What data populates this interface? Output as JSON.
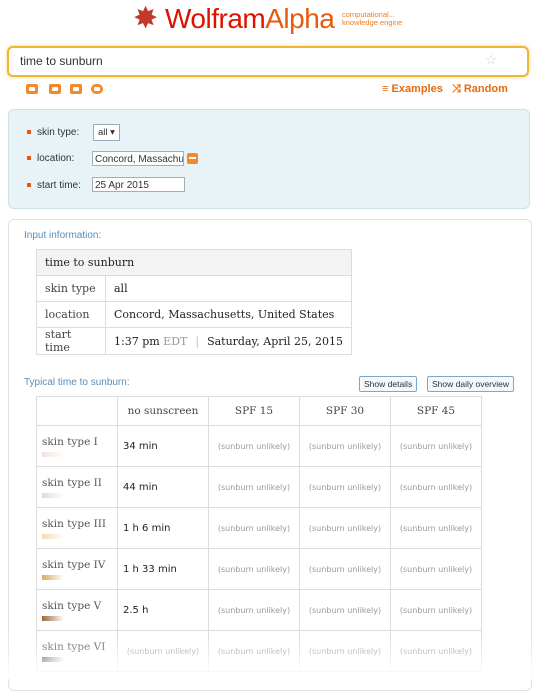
{
  "logo": {
    "name": "WolframAlpha",
    "tagline1": "computational...",
    "tagline2": "knowledge engine"
  },
  "search": {
    "value": "time to sunburn"
  },
  "toolbar": {
    "examples": "Examples",
    "random": "Random"
  },
  "assumptions": {
    "skin_type_label": "skin type:",
    "skin_type_value": "all ▾",
    "location_label": "location:",
    "location_value": "Concord, Massachusetts",
    "start_time_label": "start time:",
    "start_time_value": "25 Apr 2015"
  },
  "input_pod": {
    "title": "Input information:",
    "query": "time to sunburn",
    "rows": [
      {
        "label": "skin type",
        "value": "all"
      },
      {
        "label": "location",
        "value": "Concord, Massachusetts, United States"
      }
    ],
    "start_label": "start time",
    "start_time": "1:37 pm",
    "start_zone": "EDT",
    "start_sep": "|",
    "start_date": "Saturday, April 25, 2015"
  },
  "sunburn_pod": {
    "title": "Typical time to sunburn:",
    "show_details": "Show details",
    "show_daily": "Show daily overview",
    "columns": [
      "no sunscreen",
      "SPF 15",
      "SPF 30",
      "SPF 45"
    ],
    "rows": [
      {
        "label": "skin type I",
        "swatch": "#f1e4dc",
        "values": [
          "34 min",
          "(sunburn unlikely)",
          "(sunburn unlikely)",
          "(sunburn unlikely)"
        ]
      },
      {
        "label": "skin type II",
        "swatch": "#ecd8c6",
        "values": [
          "44 min",
          "(sunburn unlikely)",
          "(sunburn unlikely)",
          "(sunburn unlikely)"
        ]
      },
      {
        "label": "skin type III",
        "swatch": "#f1dcb0",
        "values": [
          "1 h 6 min",
          "(sunburn unlikely)",
          "(sunburn unlikely)",
          "(sunburn unlikely)"
        ]
      },
      {
        "label": "skin type IV",
        "swatch": "#d8ac62",
        "values": [
          "1 h 33 min",
          "(sunburn unlikely)",
          "(sunburn unlikely)",
          "(sunburn unlikely)"
        ]
      },
      {
        "label": "skin type V",
        "swatch": "#9b6a3e",
        "values": [
          "2.5 h",
          "(sunburn unlikely)",
          "(sunburn unlikely)",
          "(sunburn unlikely)"
        ]
      },
      {
        "label": "skin type VI",
        "swatch": "#5a3a2a",
        "values": [
          "(sunburn unlikely)",
          "(sunburn unlikely)",
          "(sunburn unlikely)",
          "(sunburn unlikely)"
        ]
      }
    ]
  },
  "colors": {
    "accent": "#e66a0a",
    "brand": "#dd1100",
    "panel": "#e8f3f7",
    "link": "#5b8db6"
  }
}
